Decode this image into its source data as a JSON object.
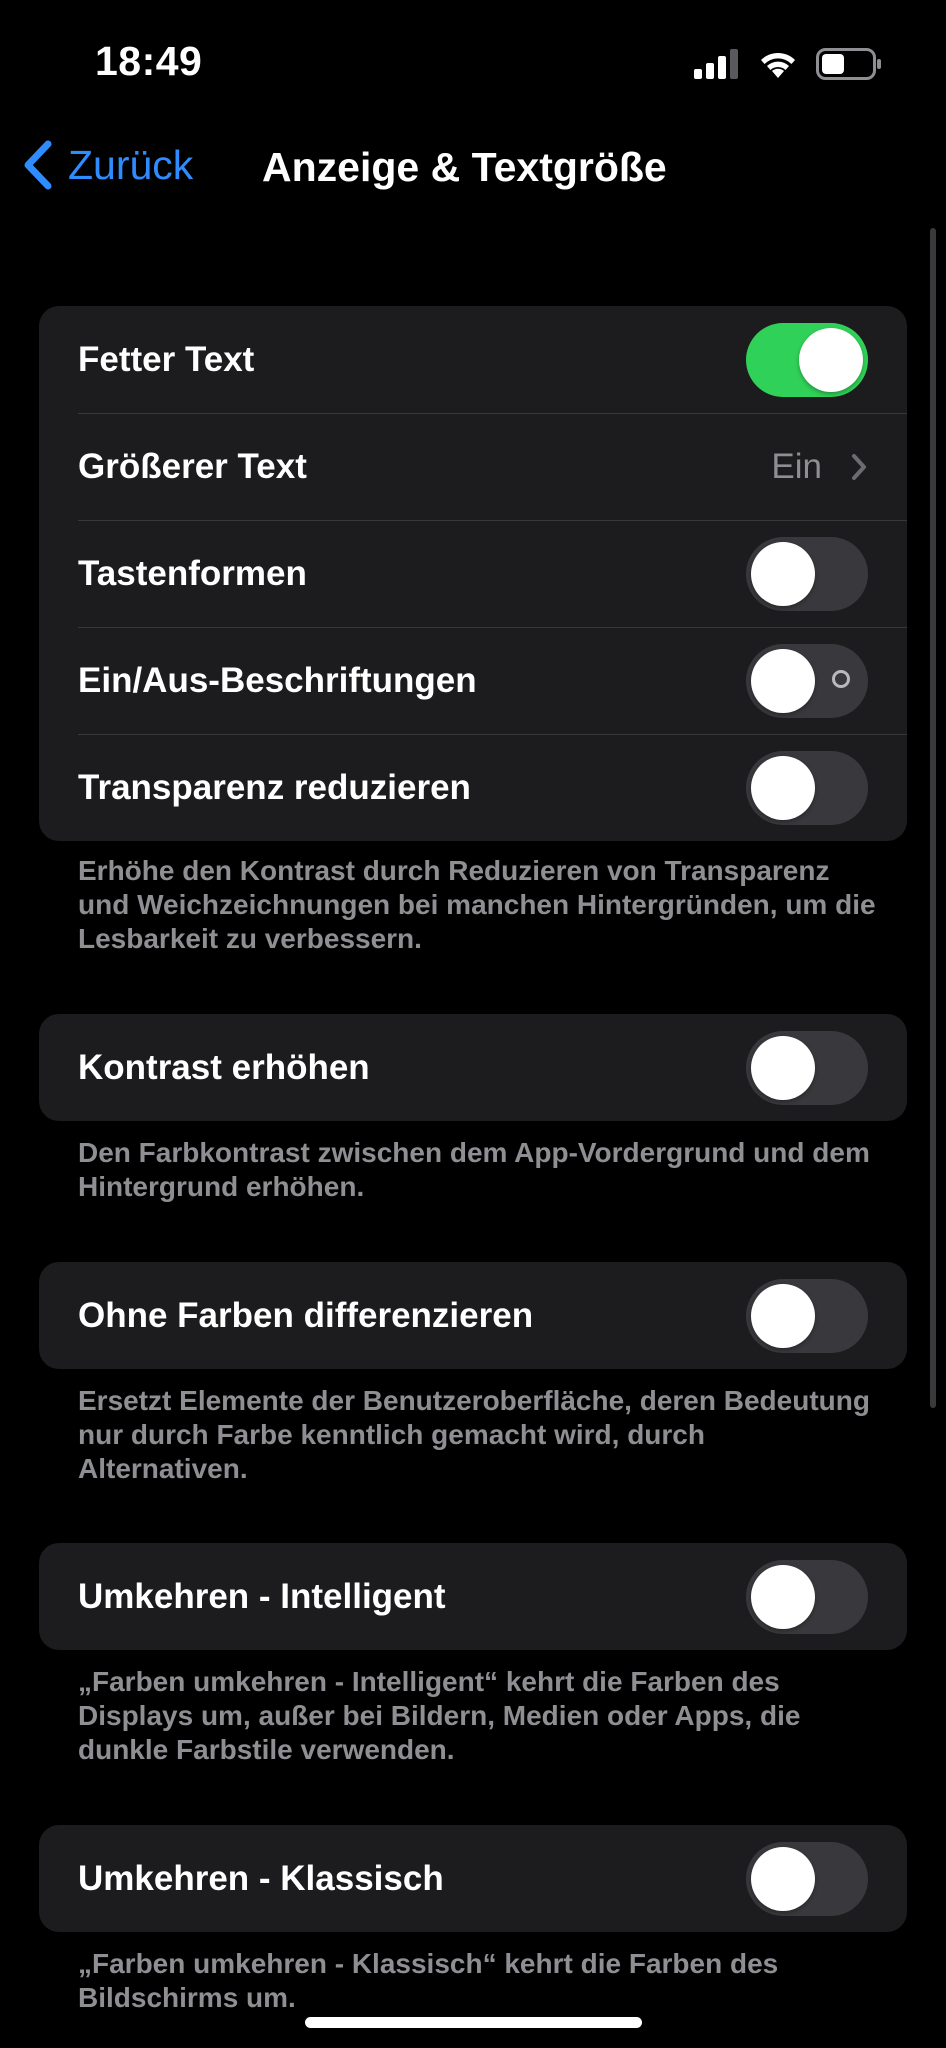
{
  "status_bar": {
    "time": "18:49",
    "icons": [
      "cellular-signal-icon",
      "wifi-icon",
      "battery-icon"
    ]
  },
  "nav": {
    "back_label": "Zurück",
    "title": "Anzeige & Textgröße"
  },
  "colors": {
    "accent": "#2f8cff",
    "toggle_on": "#30d158",
    "toggle_off": "#39393d",
    "group_bg": "#1c1c1e",
    "secondary_text": "#8e8e93"
  },
  "groups": [
    {
      "rows": [
        {
          "label": "Fetter Text",
          "type": "toggle",
          "on": true
        },
        {
          "label": "Größerer Text",
          "type": "disclosure",
          "value": "Ein"
        },
        {
          "label": "Tastenformen",
          "type": "toggle",
          "on": false
        },
        {
          "label": "Ein/Aus-Beschriftungen",
          "type": "toggle",
          "on": false
        },
        {
          "label": "Transparenz reduzieren",
          "type": "toggle",
          "on": false
        }
      ],
      "footer": "Erhöhe den Kontrast durch Reduzieren von Transparenz und Weichzeichnungen bei manchen Hintergründen, um die Lesbarkeit zu verbessern."
    },
    {
      "rows": [
        {
          "label": "Kontrast erhöhen",
          "type": "toggle",
          "on": false
        }
      ],
      "footer": "Den Farbkontrast zwischen dem App-Vordergrund und dem Hintergrund erhöhen."
    },
    {
      "rows": [
        {
          "label": "Ohne Farben differenzieren",
          "type": "toggle",
          "on": false
        }
      ],
      "footer": "Ersetzt Elemente der Benutzeroberfläche, deren Bedeutung nur durch Farbe kenntlich gemacht wird, durch Alternativen."
    },
    {
      "rows": [
        {
          "label": "Umkehren - Intelligent",
          "type": "toggle",
          "on": false
        }
      ],
      "footer": "„Farben umkehren - Intelligent“ kehrt die Farben des Displays um, außer bei Bildern, Medien oder Apps, die dunkle Farbstile verwenden."
    },
    {
      "rows": [
        {
          "label": "Umkehren - Klassisch",
          "type": "toggle",
          "on": false
        }
      ],
      "footer": "„Farben umkehren - Klassisch“ kehrt die Farben des Bildschirms um."
    }
  ]
}
